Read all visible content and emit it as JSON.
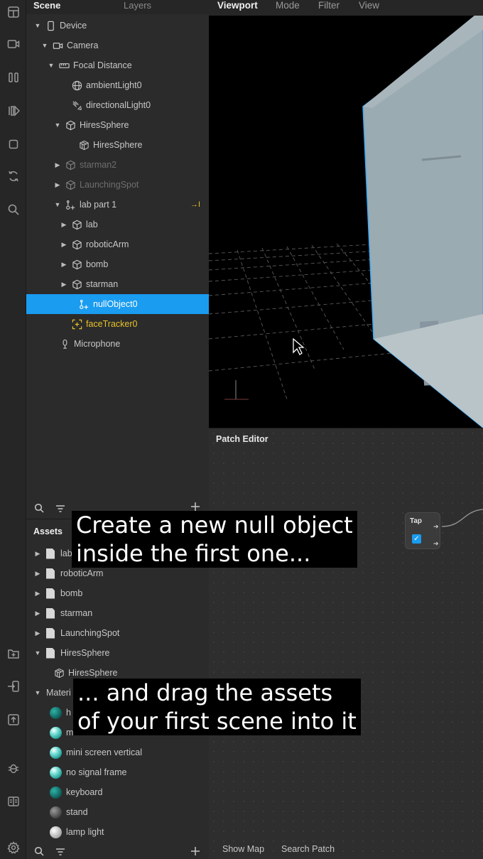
{
  "scene_panel": {
    "tabs": [
      "Scene",
      "Layers"
    ],
    "tree": [
      {
        "label": "Device",
        "arrow": "▼",
        "icon": "device-icon"
      },
      {
        "label": "Camera",
        "arrow": "▼",
        "icon": "camera-icon"
      },
      {
        "label": "Focal Distance",
        "arrow": "▼",
        "icon": "focal-distance-icon"
      },
      {
        "label": "ambientLight0",
        "arrow": "",
        "icon": "ambient-light-icon"
      },
      {
        "label": "directionalLight0",
        "arrow": "",
        "icon": "directional-light-icon"
      },
      {
        "label": "HiresSphere",
        "arrow": "▼",
        "icon": "cube-icon"
      },
      {
        "label": "HiresSphere",
        "arrow": "",
        "icon": "mesh-icon"
      },
      {
        "label": "starman2",
        "arrow": "▶",
        "icon": "cube-icon",
        "state": "dim"
      },
      {
        "label": "LaunchingSpot",
        "arrow": "▶",
        "icon": "cube-icon",
        "state": "dim"
      },
      {
        "label": "lab part 1",
        "arrow": "▼",
        "icon": "null-object-icon",
        "badge": "→I"
      },
      {
        "label": "lab",
        "arrow": "▶",
        "icon": "cube-icon"
      },
      {
        "label": "roboticArm",
        "arrow": "▶",
        "icon": "cube-icon"
      },
      {
        "label": "bomb",
        "arrow": "▶",
        "icon": "cube-icon"
      },
      {
        "label": "starman",
        "arrow": "▶",
        "icon": "cube-icon"
      },
      {
        "label": "nullObject0",
        "arrow": "",
        "icon": "null-object-icon",
        "state": "selected"
      },
      {
        "label": "faceTracker0",
        "arrow": "",
        "icon": "face-tracker-icon",
        "state": "yellow"
      },
      {
        "label": "Microphone",
        "arrow": "",
        "icon": "microphone-icon"
      }
    ]
  },
  "assets_panel": {
    "title": "Assets",
    "items": [
      {
        "label": "lab",
        "arrow": "▶",
        "icon": "file"
      },
      {
        "label": "roboticArm",
        "arrow": "▶",
        "icon": "file"
      },
      {
        "label": "bomb",
        "arrow": "▶",
        "icon": "file"
      },
      {
        "label": "starman",
        "arrow": "▶",
        "icon": "file"
      },
      {
        "label": "LaunchingSpot",
        "arrow": "▶",
        "icon": "file"
      },
      {
        "label": "HiresSphere",
        "arrow": "▼",
        "icon": "file"
      },
      {
        "label": "HiresSphere",
        "arrow": "",
        "icon": "mesh"
      },
      {
        "label": "Materi",
        "arrow": "▼",
        "icon": "none"
      },
      {
        "label": "h",
        "arrow": "",
        "icon": "ball-teal-dark"
      },
      {
        "label": "m",
        "arrow": "",
        "icon": "ball-teal-light"
      },
      {
        "label": "mini screen vertical",
        "arrow": "",
        "icon": "ball-teal-light"
      },
      {
        "label": "no signal frame",
        "arrow": "",
        "icon": "ball-teal-light"
      },
      {
        "label": "keyboard",
        "arrow": "",
        "icon": "ball-teal-dark"
      },
      {
        "label": "stand",
        "arrow": "",
        "icon": "ball-gray"
      },
      {
        "label": "lamp light",
        "arrow": "",
        "icon": "ball-white"
      }
    ]
  },
  "viewport": {
    "tabs": [
      "Viewport",
      "Mode",
      "Filter",
      "View"
    ]
  },
  "patch_editor": {
    "title": "Patch Editor",
    "node_label": "Tap",
    "footer": [
      "Show Map",
      "Search Patch"
    ]
  },
  "captions": {
    "top": "Create a new null object\ninside the first one...",
    "bottom": "... and drag the assets\nof your first scene into it"
  },
  "colors": {
    "selection": "#1a9cf0",
    "highlight_yellow": "#e6c229",
    "cube_edge": "#3fa9f5"
  }
}
